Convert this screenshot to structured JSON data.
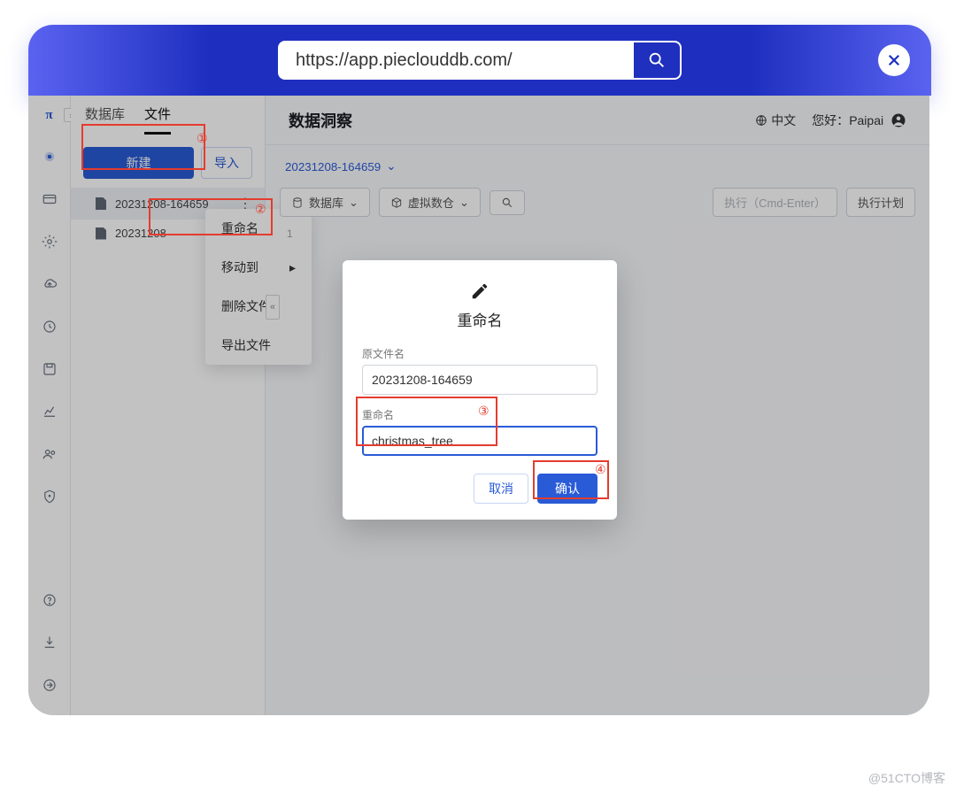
{
  "browser": {
    "url": "https://app.pieclouddb.com/"
  },
  "side": {
    "tab_db": "数据库",
    "tab_file": "文件",
    "new_btn": "新建",
    "import_btn": "导入",
    "file1": "20231208-164659",
    "file2": "20231208"
  },
  "context_menu": {
    "rename": "重命名",
    "move": "移动到",
    "delete": "删除文件",
    "export": "导出文件"
  },
  "header": {
    "title": "数据洞察",
    "lang": "中文",
    "greeting": "您好：",
    "user": "Paipai"
  },
  "tabline": {
    "active": "20231208-164659"
  },
  "toolbar": {
    "db": "数据库",
    "vw": "虚拟数仓",
    "run": "执行（Cmd-Enter）",
    "plan": "执行计划"
  },
  "editor": {
    "line1": "1"
  },
  "modal": {
    "title": "重命名",
    "label_orig": "原文件名",
    "orig": "20231208-164659",
    "label_new": "重命名",
    "new": "christmas_tree",
    "cancel": "取消",
    "confirm": "确认"
  },
  "annotations": {
    "a1": "①",
    "a2": "②",
    "a3": "③",
    "a4": "④"
  },
  "watermark": "@51CTO博客"
}
